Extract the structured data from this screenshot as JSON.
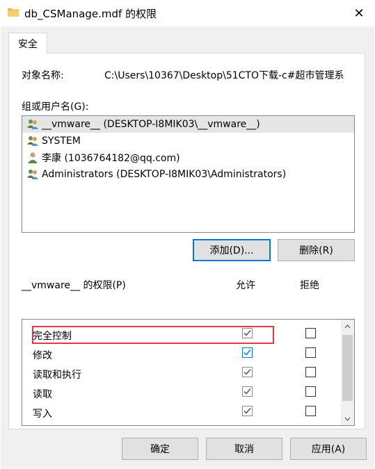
{
  "window": {
    "title": "db_CSManage.mdf 的权限",
    "close_glyph": "✕"
  },
  "tabs": [
    {
      "label": "安全"
    }
  ],
  "object": {
    "label": "对象名称:",
    "value": "C:\\Users\\10367\\Desktop\\51CTO下载-c#超市管理系"
  },
  "users": {
    "label": "组或用户名(G):",
    "items": [
      {
        "name": "__vmware__ (DESKTOP-I8MIK03\\__vmware__)",
        "icon": "group-icon",
        "selected": true
      },
      {
        "name": "SYSTEM",
        "icon": "group-icon",
        "selected": false
      },
      {
        "name": "李康 (1036764182@qq.com)",
        "icon": "user-icon",
        "selected": false
      },
      {
        "name": "Administrators (DESKTOP-I8MIK03\\Administrators)",
        "icon": "group-icon",
        "selected": false
      }
    ]
  },
  "buttons": {
    "add": "添加(D)...",
    "remove": "删除(R)",
    "ok": "确定",
    "cancel": "取消",
    "apply": "应用(A)"
  },
  "permissions": {
    "label": "__vmware__ 的权限(P)",
    "allow_header": "允许",
    "deny_header": "拒绝",
    "rows": [
      {
        "name": "完全控制",
        "allow": true,
        "deny": false,
        "highlighted": true
      },
      {
        "name": "修改",
        "allow": true,
        "deny": false,
        "highlighted": false
      },
      {
        "name": "读取和执行",
        "allow": true,
        "deny": false,
        "highlighted": false
      },
      {
        "name": "读取",
        "allow": true,
        "deny": false,
        "highlighted": false
      },
      {
        "name": "写入",
        "allow": true,
        "deny": false,
        "highlighted": false
      }
    ]
  },
  "colors": {
    "highlight": "#e03a3a",
    "focus": "#0078d7",
    "selected_row": "#e5e5e5"
  }
}
